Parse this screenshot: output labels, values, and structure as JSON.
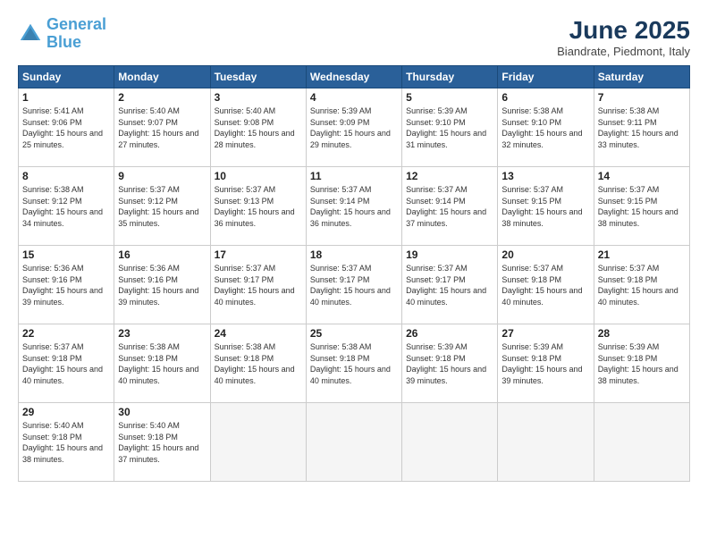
{
  "logo": {
    "text1": "General",
    "text2": "Blue"
  },
  "title": "June 2025",
  "subtitle": "Biandrate, Piedmont, Italy",
  "weekdays": [
    "Sunday",
    "Monday",
    "Tuesday",
    "Wednesday",
    "Thursday",
    "Friday",
    "Saturday"
  ],
  "weeks": [
    [
      {
        "day": "1",
        "sunrise": "5:41 AM",
        "sunset": "9:06 PM",
        "daylight": "15 hours and 25 minutes."
      },
      {
        "day": "2",
        "sunrise": "5:40 AM",
        "sunset": "9:07 PM",
        "daylight": "15 hours and 27 minutes."
      },
      {
        "day": "3",
        "sunrise": "5:40 AM",
        "sunset": "9:08 PM",
        "daylight": "15 hours and 28 minutes."
      },
      {
        "day": "4",
        "sunrise": "5:39 AM",
        "sunset": "9:09 PM",
        "daylight": "15 hours and 29 minutes."
      },
      {
        "day": "5",
        "sunrise": "5:39 AM",
        "sunset": "9:10 PM",
        "daylight": "15 hours and 31 minutes."
      },
      {
        "day": "6",
        "sunrise": "5:38 AM",
        "sunset": "9:10 PM",
        "daylight": "15 hours and 32 minutes."
      },
      {
        "day": "7",
        "sunrise": "5:38 AM",
        "sunset": "9:11 PM",
        "daylight": "15 hours and 33 minutes."
      }
    ],
    [
      {
        "day": "8",
        "sunrise": "5:38 AM",
        "sunset": "9:12 PM",
        "daylight": "15 hours and 34 minutes."
      },
      {
        "day": "9",
        "sunrise": "5:37 AM",
        "sunset": "9:12 PM",
        "daylight": "15 hours and 35 minutes."
      },
      {
        "day": "10",
        "sunrise": "5:37 AM",
        "sunset": "9:13 PM",
        "daylight": "15 hours and 36 minutes."
      },
      {
        "day": "11",
        "sunrise": "5:37 AM",
        "sunset": "9:14 PM",
        "daylight": "15 hours and 36 minutes."
      },
      {
        "day": "12",
        "sunrise": "5:37 AM",
        "sunset": "9:14 PM",
        "daylight": "15 hours and 37 minutes."
      },
      {
        "day": "13",
        "sunrise": "5:37 AM",
        "sunset": "9:15 PM",
        "daylight": "15 hours and 38 minutes."
      },
      {
        "day": "14",
        "sunrise": "5:37 AM",
        "sunset": "9:15 PM",
        "daylight": "15 hours and 38 minutes."
      }
    ],
    [
      {
        "day": "15",
        "sunrise": "5:36 AM",
        "sunset": "9:16 PM",
        "daylight": "15 hours and 39 minutes."
      },
      {
        "day": "16",
        "sunrise": "5:36 AM",
        "sunset": "9:16 PM",
        "daylight": "15 hours and 39 minutes."
      },
      {
        "day": "17",
        "sunrise": "5:37 AM",
        "sunset": "9:17 PM",
        "daylight": "15 hours and 40 minutes."
      },
      {
        "day": "18",
        "sunrise": "5:37 AM",
        "sunset": "9:17 PM",
        "daylight": "15 hours and 40 minutes."
      },
      {
        "day": "19",
        "sunrise": "5:37 AM",
        "sunset": "9:17 PM",
        "daylight": "15 hours and 40 minutes."
      },
      {
        "day": "20",
        "sunrise": "5:37 AM",
        "sunset": "9:18 PM",
        "daylight": "15 hours and 40 minutes."
      },
      {
        "day": "21",
        "sunrise": "5:37 AM",
        "sunset": "9:18 PM",
        "daylight": "15 hours and 40 minutes."
      }
    ],
    [
      {
        "day": "22",
        "sunrise": "5:37 AM",
        "sunset": "9:18 PM",
        "daylight": "15 hours and 40 minutes."
      },
      {
        "day": "23",
        "sunrise": "5:38 AM",
        "sunset": "9:18 PM",
        "daylight": "15 hours and 40 minutes."
      },
      {
        "day": "24",
        "sunrise": "5:38 AM",
        "sunset": "9:18 PM",
        "daylight": "15 hours and 40 minutes."
      },
      {
        "day": "25",
        "sunrise": "5:38 AM",
        "sunset": "9:18 PM",
        "daylight": "15 hours and 40 minutes."
      },
      {
        "day": "26",
        "sunrise": "5:39 AM",
        "sunset": "9:18 PM",
        "daylight": "15 hours and 39 minutes."
      },
      {
        "day": "27",
        "sunrise": "5:39 AM",
        "sunset": "9:18 PM",
        "daylight": "15 hours and 39 minutes."
      },
      {
        "day": "28",
        "sunrise": "5:39 AM",
        "sunset": "9:18 PM",
        "daylight": "15 hours and 38 minutes."
      }
    ],
    [
      {
        "day": "29",
        "sunrise": "5:40 AM",
        "sunset": "9:18 PM",
        "daylight": "15 hours and 38 minutes."
      },
      {
        "day": "30",
        "sunrise": "5:40 AM",
        "sunset": "9:18 PM",
        "daylight": "15 hours and 37 minutes."
      },
      null,
      null,
      null,
      null,
      null
    ]
  ],
  "colors": {
    "header_bg": "#2a6099",
    "header_text": "#ffffff",
    "border": "#cccccc",
    "empty_bg": "#f5f5f5"
  }
}
